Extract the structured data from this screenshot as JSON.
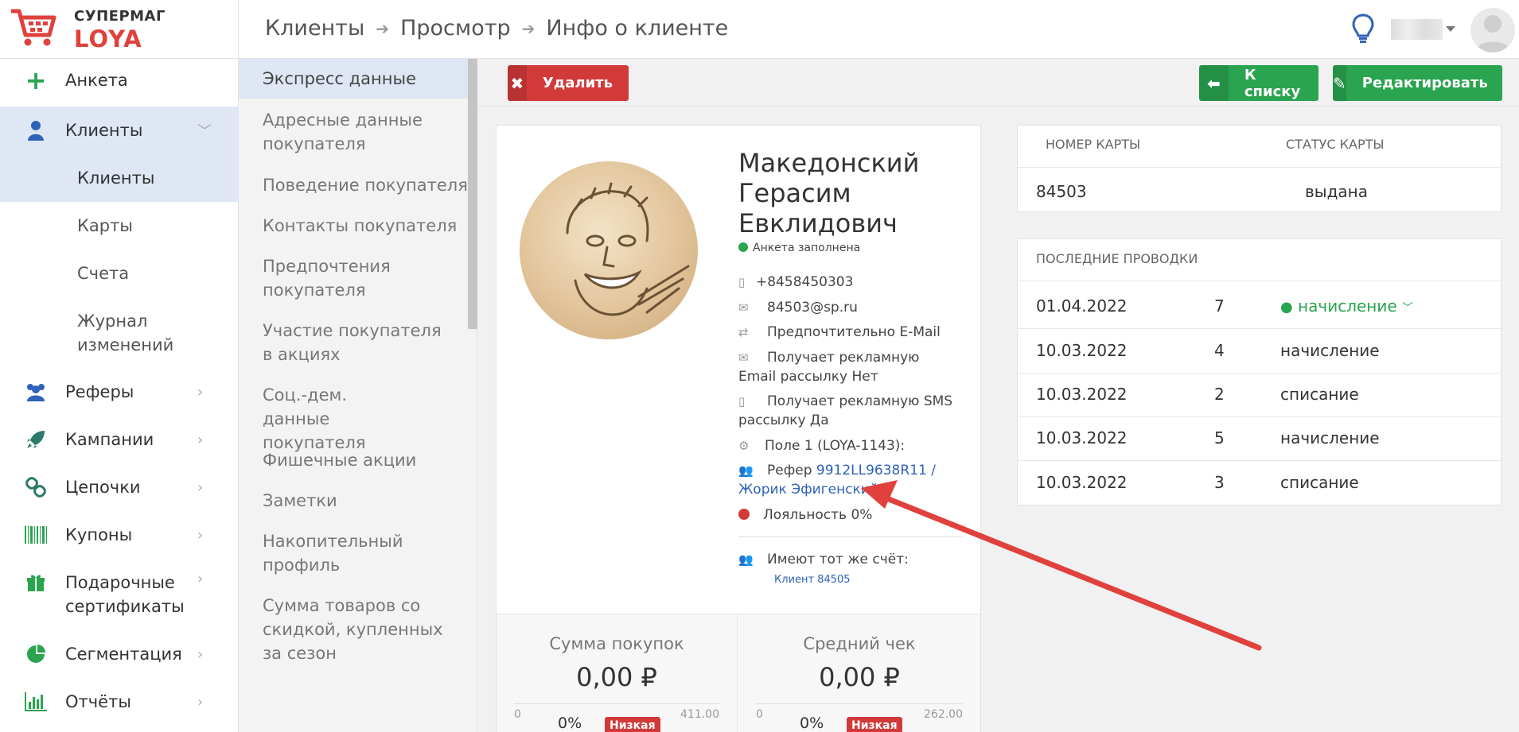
{
  "brand": {
    "line1": "СУПЕРМАГ",
    "line2": "LOYA"
  },
  "breadcrumb": [
    "Клиенты",
    "Просмотр",
    "Инфо о клиенте"
  ],
  "sidebar": {
    "items": [
      {
        "label": "Анкета",
        "icon": "plus-icon"
      },
      {
        "label": "Клиенты",
        "icon": "user-icon"
      },
      {
        "label": "Клиенты",
        "icon": ""
      },
      {
        "label": "Карты",
        "icon": ""
      },
      {
        "label": "Счета",
        "icon": ""
      },
      {
        "label": "Журнал изменений",
        "icon": ""
      },
      {
        "label": "Реферы",
        "icon": "users-icon"
      },
      {
        "label": "Кампании",
        "icon": "rocket-icon"
      },
      {
        "label": "Цепочки",
        "icon": "chain-icon"
      },
      {
        "label": "Купоны",
        "icon": "barcode-icon"
      },
      {
        "label": "Подарочные сертификаты",
        "icon": "gift-icon"
      },
      {
        "label": "Сегментация",
        "icon": "pie-chart-icon"
      },
      {
        "label": "Отчёты",
        "icon": "bar-chart-icon"
      }
    ]
  },
  "subnav": [
    "Экспресс данные",
    "Адресные данные покупателя",
    "Поведение покупателя",
    "Контакты покупателя",
    "Предпочтения покупателя",
    "Участие покупателя в акциях",
    "Соц.-дем. данные покупателя",
    "Фишечные акции",
    "Заметки",
    "Накопительный профиль",
    "Сумма товаров со скидкой, купленных за сезон"
  ],
  "toolbar": {
    "delete_label": "Удалить",
    "back_label": "К списку",
    "edit_label": "Редактировать"
  },
  "client": {
    "name_line1": "Македонский",
    "name_line2": "Герасим",
    "name_line3": "Евклидович",
    "status": "Анкета заполнена",
    "phone": "+8458450303",
    "email": "84503@sp.ru",
    "preference": "Предпочтительно E-Mail",
    "email_ads": "Получает рекламную Email рассылку Нет",
    "sms_ads": "Получает рекламную SMS рассылку Да",
    "field1": "Поле 1 (LOYA-1143):",
    "referer_label": "Рефер",
    "referer_link": "9912LL9638R11 / Жорик Эфигенский",
    "loyalty": "Лояльность 0%",
    "same_account_label": "Имеют тот же счёт:",
    "same_account_link": "Клиент 84505"
  },
  "stats": {
    "purchases": {
      "title": "Сумма покупок",
      "value": "0,00 ₽",
      "min": "0",
      "max": "411.00",
      "pct": "0%",
      "badge": "Низкая"
    },
    "avg_check": {
      "title": "Средний чек",
      "value": "0,00 ₽",
      "min": "0",
      "max": "262.00",
      "pct": "0%",
      "badge": "Низкая"
    }
  },
  "card_table": {
    "headers": [
      "НОМЕР КАРТЫ",
      "СТАТУС КАРТЫ"
    ],
    "row": [
      "84503",
      "выдана"
    ]
  },
  "transactions": {
    "title": "ПОСЛЕДНИЕ ПРОВОДКИ",
    "rows": [
      [
        "01.04.2022",
        "7",
        "начисление"
      ],
      [
        "10.03.2022",
        "4",
        "начисление"
      ],
      [
        "10.03.2022",
        "2",
        "списание"
      ],
      [
        "10.03.2022",
        "5",
        "начисление"
      ],
      [
        "10.03.2022",
        "3",
        "списание"
      ]
    ]
  },
  "colors": {
    "accent_red": "#d23a3a",
    "accent_green": "#2aa44f",
    "link_blue": "#2f62b8",
    "annotation_arrow": "#e0413c"
  }
}
